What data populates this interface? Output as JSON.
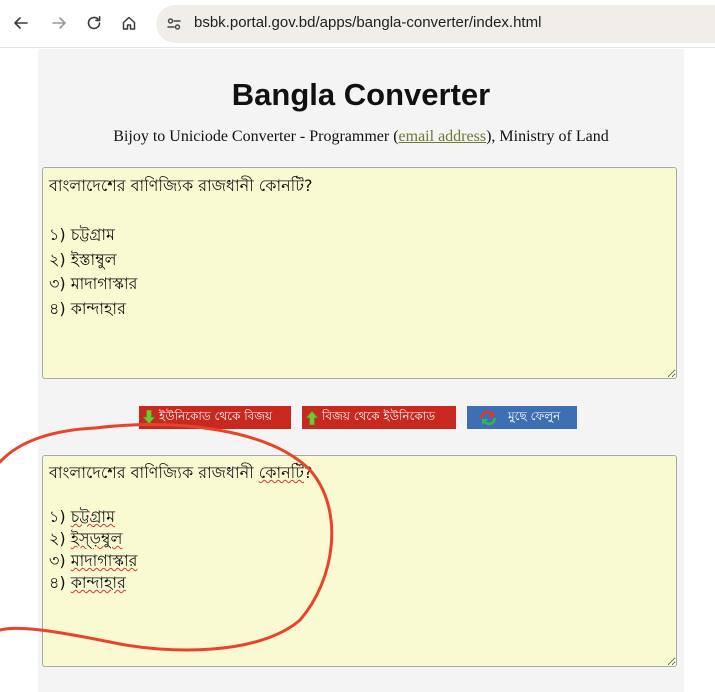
{
  "browser": {
    "url": "bsbk.portal.gov.bd/apps/bangla-converter/index.html"
  },
  "page": {
    "title": "Bangla Converter",
    "subtitle_before": "Bijoy to Uniciode Converter - Programmer (",
    "subtitle_link": "email address",
    "subtitle_after": "), Ministry of Land"
  },
  "input_box": {
    "lines": [
      "বাংলাদেশের বাণিজ্যিক রাজধানী কোনটি?",
      "",
      "১) চট্টগ্রাম",
      "২) ইস্তাম্বুল",
      "৩) মাদাগাস্কার",
      "৪) কান্দাহার"
    ]
  },
  "buttons": {
    "to_bijoy": "ইউনিকোড থেকে বিজয়",
    "to_unicode": "বিজয় থেকে ইউনিকোড",
    "clear": "মুছে ফেলুন"
  },
  "output_box": {
    "line1_a": "বাংলাদেশের বাণিজ্যিক রাজধানী ",
    "line1_b": "কোনটি",
    "line1_c": "?",
    "opt1_prefix": "১) ",
    "opt1_word": "চট্টগ্রাম",
    "opt2_prefix": "২) ",
    "opt2_word": "ইস্ড়ম্বুল",
    "opt3_prefix": "৩) ",
    "opt3_word": "মাদাগাস্কার",
    "opt4_prefix": "৪) ",
    "opt4_word": "কান্দাহার"
  },
  "colors": {
    "textbox_bg": "#fafad2",
    "convert_button": "#c8281e",
    "clear_button": "#3f6fb3",
    "annotation_circle": "#e8442a",
    "link": "#6b7a35"
  }
}
